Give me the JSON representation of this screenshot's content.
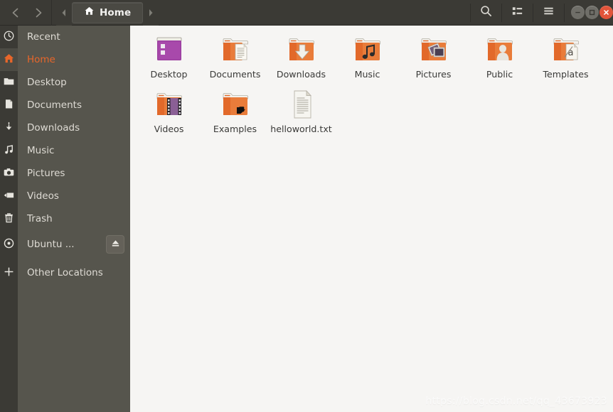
{
  "window": {
    "title": "Home"
  },
  "header": {
    "back_label": "Back",
    "forward_label": "Forward",
    "tab_prev_label": "Previous tab",
    "tab_next_label": "Next tab",
    "tab": {
      "label": "Home",
      "icon": "home-icon"
    },
    "tools": [
      {
        "name": "search-button",
        "icon": "search-icon",
        "label": "Search"
      },
      {
        "name": "view-toggle-button",
        "icon": "list-view-icon",
        "label": "View options"
      },
      {
        "name": "menu-button",
        "icon": "hamburger-menu-icon",
        "label": "Menu"
      }
    ],
    "window_controls": [
      {
        "name": "minimize-button",
        "icon": "minimize-icon",
        "label": "Minimize",
        "color": "#6f6e68"
      },
      {
        "name": "maximize-button",
        "icon": "maximize-icon",
        "label": "Maximize",
        "color": "#6f6e68"
      },
      {
        "name": "close-button",
        "icon": "close-icon",
        "label": "Close",
        "color": "#e2543a"
      }
    ]
  },
  "sidebar": {
    "accent_color": "#e8662a",
    "background_color": "#56554d",
    "items": [
      {
        "label": "Recent",
        "icon": "clock-icon",
        "active": false,
        "eject": false
      },
      {
        "label": "Home",
        "icon": "home-icon",
        "active": true,
        "eject": false
      },
      {
        "label": "Desktop",
        "icon": "folder-icon",
        "active": false,
        "eject": false
      },
      {
        "label": "Documents",
        "icon": "document-icon",
        "active": false,
        "eject": false
      },
      {
        "label": "Downloads",
        "icon": "download-icon",
        "active": false,
        "eject": false
      },
      {
        "label": "Music",
        "icon": "music-note-icon",
        "active": false,
        "eject": false
      },
      {
        "label": "Pictures",
        "icon": "camera-icon",
        "active": false,
        "eject": false
      },
      {
        "label": "Videos",
        "icon": "video-icon",
        "active": false,
        "eject": false
      },
      {
        "label": "Trash",
        "icon": "trash-icon",
        "active": false,
        "eject": false
      },
      {
        "label": "Ubuntu ...",
        "icon": "disc-icon",
        "active": false,
        "eject": true,
        "eject_icon": "eject-icon"
      },
      {
        "label": "Other Locations",
        "icon": "plus-icon",
        "active": false,
        "eject": false
      }
    ]
  },
  "main": {
    "background_color": "#f6f5f3",
    "files": [
      {
        "label": "Desktop",
        "icon": "folder-desktop-icon",
        "type": "folder"
      },
      {
        "label": "Documents",
        "icon": "folder-documents-icon",
        "type": "folder"
      },
      {
        "label": "Downloads",
        "icon": "folder-downloads-icon",
        "type": "folder"
      },
      {
        "label": "Music",
        "icon": "folder-music-icon",
        "type": "folder"
      },
      {
        "label": "Pictures",
        "icon": "folder-pictures-icon",
        "type": "folder"
      },
      {
        "label": "Public",
        "icon": "folder-public-icon",
        "type": "folder"
      },
      {
        "label": "Templates",
        "icon": "folder-templates-icon",
        "type": "folder"
      },
      {
        "label": "Videos",
        "icon": "folder-videos-icon",
        "type": "folder"
      },
      {
        "label": "Examples",
        "icon": "folder-symlink-icon",
        "type": "symlink"
      },
      {
        "label": "helloworld.txt",
        "icon": "text-file-icon",
        "type": "file"
      }
    ]
  },
  "watermark": {
    "text": "https://blog.csdn.net/qq_43673923"
  }
}
